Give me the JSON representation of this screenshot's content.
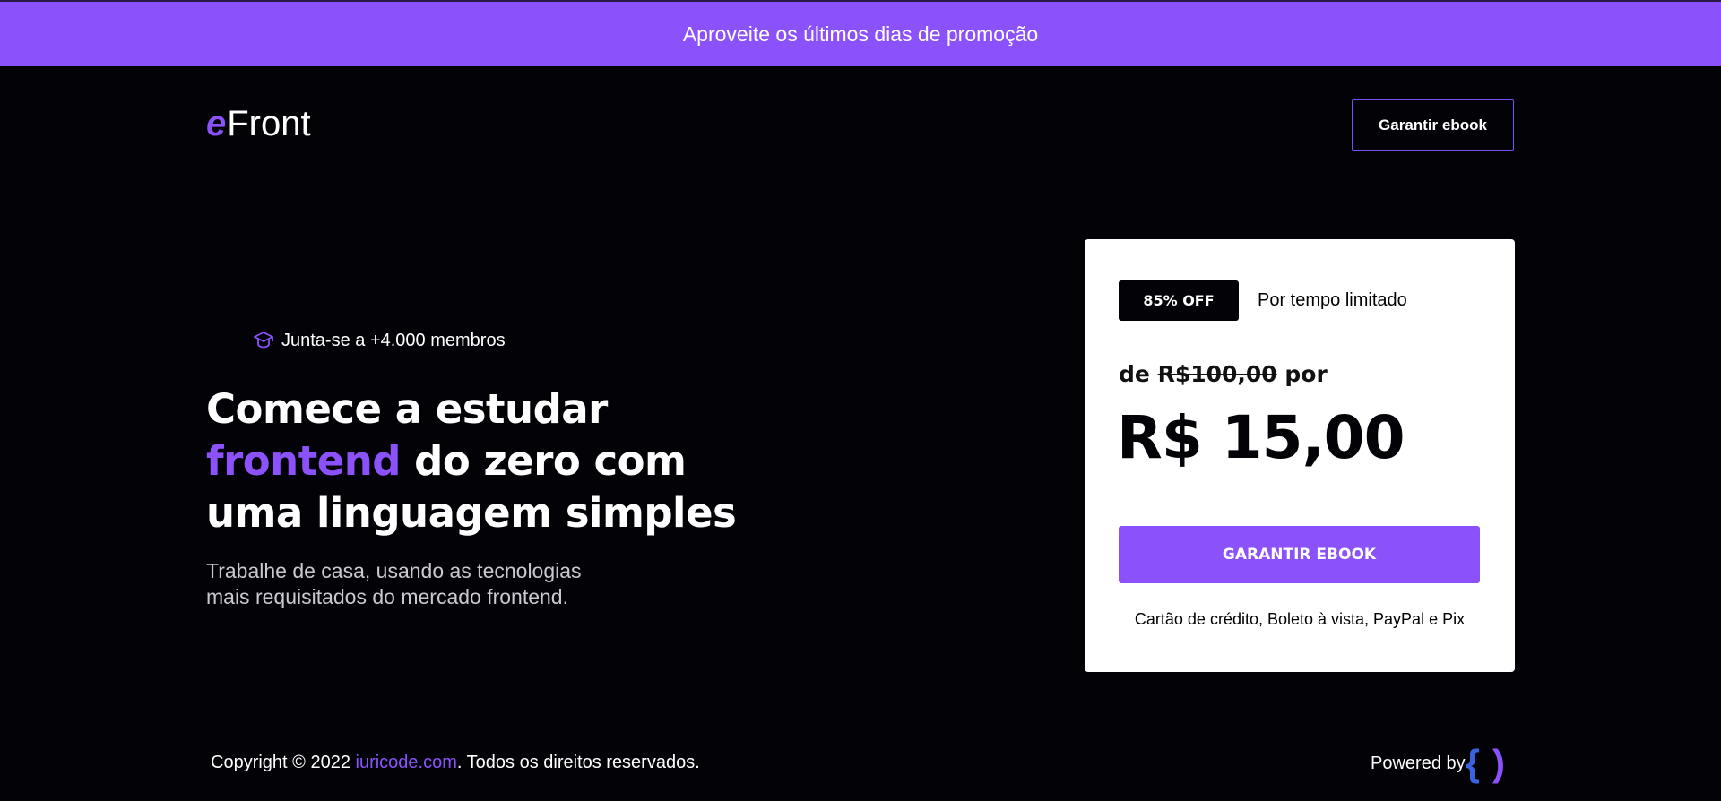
{
  "promo": {
    "text": "Aproveite os últimos dias de promoção"
  },
  "header": {
    "logo_mark": "e",
    "logo_text": "Front",
    "cta_label": "Garantir ebook"
  },
  "hero": {
    "members_text": "Junta-se a +4.000 membros",
    "headline_part1": "Comece a estudar",
    "headline_accent": "frontend",
    "headline_part2": " do zero com",
    "headline_part3": "uma linguagem simples",
    "subtext_line1": "Trabalhe de casa, usando as tecnologias",
    "subtext_line2": "mais requisitados do mercado frontend."
  },
  "offer": {
    "badge": "85% OFF",
    "badge_note": "Por tempo limitado",
    "old_price_prefix": "de ",
    "old_price": "R$100,00",
    "old_price_suffix": " por",
    "price": "R$ 15,00",
    "cta_label": "GARANTIR EBOOK",
    "payment_methods": "Cartão de crédito, Boleto à vista, PayPal e Pix"
  },
  "footer": {
    "copyright_prefix": "Copyright © 2022 ",
    "copyright_link": "iuricode.com",
    "copyright_suffix": ". Todos os direitos reservados.",
    "powered_by": "Powered by",
    "brand_left": "{",
    "brand_right": ")"
  },
  "colors": {
    "accent": "#8b52fc",
    "background": "#030207",
    "card": "#ffffff"
  },
  "icons": [
    "graduation-cap-icon"
  ]
}
